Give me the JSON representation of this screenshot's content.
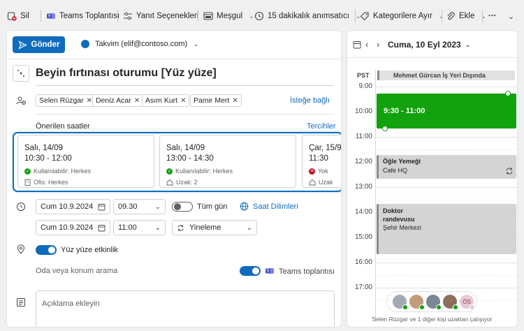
{
  "toolbar": {
    "delete": "Sil",
    "teams": "Teams Toplantısı",
    "response_options": "Yanıt Seçenekleri",
    "busy": "Meşgul",
    "reminder": "15 dakikalık anımsatıcı",
    "categorize": "Kategorilere Ayır",
    "attach": "Ekle",
    "more": "···"
  },
  "compose": {
    "send": "Gönder",
    "calendar": "Takvim (elif@contoso.com)",
    "title": "Beyin fırtınası oturumu [Yüz yüze]",
    "attendees": [
      "Selen Rüzgar",
      "Deniz Acar",
      "Asım Kurt",
      "Pamir Mert"
    ],
    "optional": "İsteğe bağlı",
    "suggested_label": "Önerilen saatler",
    "preferences": "Tercihler",
    "suggestions": [
      {
        "day": "Salı, 14/09",
        "time": "10:30 - 12:00",
        "availability": "Kullanılabilir: Herkes",
        "location": "Ofis: Herkes"
      },
      {
        "day": "Salı, 14/09",
        "time": "13:00 - 14:30",
        "availability": "Kullanılabilir: Herkes",
        "location": "Uzak: 2"
      },
      {
        "day": "Çar, 15/9",
        "time": "11:30",
        "availability": "Yok",
        "location": "Uzak"
      }
    ],
    "start_date": "Cum 10.9.2024",
    "start_time": "09.30",
    "end_date": "Cum 10.9.2024",
    "end_time": "11:00",
    "all_day": "Tüm gün",
    "timezones": "Saat Dilimleri",
    "repeat": "Yineleme",
    "in_person": "Yüz yüze etkinlik",
    "room_search": "Oda veya konum arama",
    "teams_meeting": "Teams toplantısı",
    "description_placeholder": "Açıklama ekleyin"
  },
  "calendar": {
    "date": "Cuma, 10 Eyl 2023",
    "timezone": "PST",
    "allday_banner": "Mehmet Gürcan İş Yeri Dışında",
    "hours": [
      "9:00",
      "10:00",
      "11:00",
      "12:00",
      "13:00",
      "14:00",
      "15:00",
      "16:00",
      "17:00"
    ],
    "events": [
      {
        "title": "9:30 - 11:00",
        "subtitle": ""
      },
      {
        "title": "Öğle Yemeği",
        "subtitle": "Cafe HQ"
      },
      {
        "title": "Doktor randevusu",
        "subtitle": "Şehir Merkezi"
      }
    ],
    "avatar_initials": "ÖS",
    "footer": "Selen Rüzgar ve 1 diğer kişi uzaktan çalışıyor"
  },
  "colors": {
    "accent": "#0f6cbd",
    "event_green": "#13a10e",
    "busy_gray": "#d4d4d4"
  }
}
